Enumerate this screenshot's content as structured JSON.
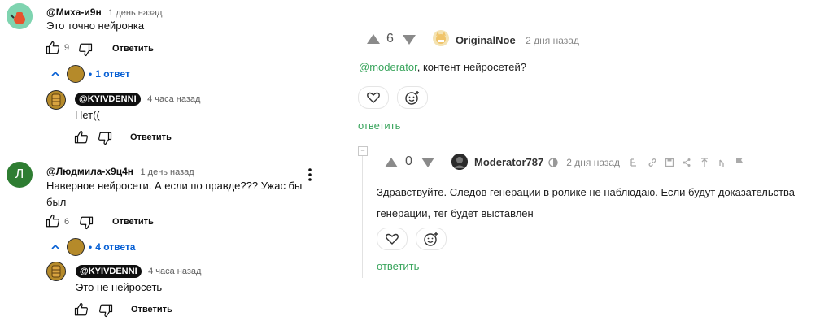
{
  "left": {
    "comments": [
      {
        "author": "@Миха-и9н",
        "time": "1 день назад",
        "text": "Это точно нейронка",
        "likes": "9",
        "reply_label": "Ответить",
        "replies_toggle": "1 ответ",
        "reply": {
          "handle": "@KYIVDENNI",
          "time": "4 часа назад",
          "text": "Нет((",
          "reply_label": "Ответить"
        }
      },
      {
        "avatar_letter": "Л",
        "author": "@Людмила-х9ц4н",
        "time": "1 день назад",
        "text_line1": "Наверное нейросети. А если по правде??? Ужас бы",
        "text_line2": "был",
        "likes": "6",
        "reply_label": "Ответить",
        "replies_toggle": "4 ответа",
        "reply": {
          "handle": "@KYIVDENNI",
          "time": "4 часа назад",
          "text": "Это не нейросеть",
          "reply_label": "Ответить"
        }
      }
    ]
  },
  "right": {
    "post": {
      "score": "6",
      "author": "OriginalNoe",
      "time": "2 дня назад",
      "mention": "@moderator",
      "text_rest": ", контент нейросетей?",
      "reply_label": "ответить"
    },
    "reply": {
      "collapse_glyph": "−",
      "score": "0",
      "author": "Moderator787",
      "time": "2 дня назад",
      "text_line1": "Здравствуйте. Следов генерации в ролике не наблюдаю. Если будут доказательства",
      "text_line2": "генерации, тег будет выставлен",
      "reply_label": "ответить"
    }
  },
  "colors": {
    "link_blue": "#065fd4",
    "reply_green": "#3aa55d",
    "avatar1_bg": "#7fd4b0",
    "avatar_l_bg": "#2e7d32",
    "kyiv_avatar_bg": "#b58a2a"
  }
}
